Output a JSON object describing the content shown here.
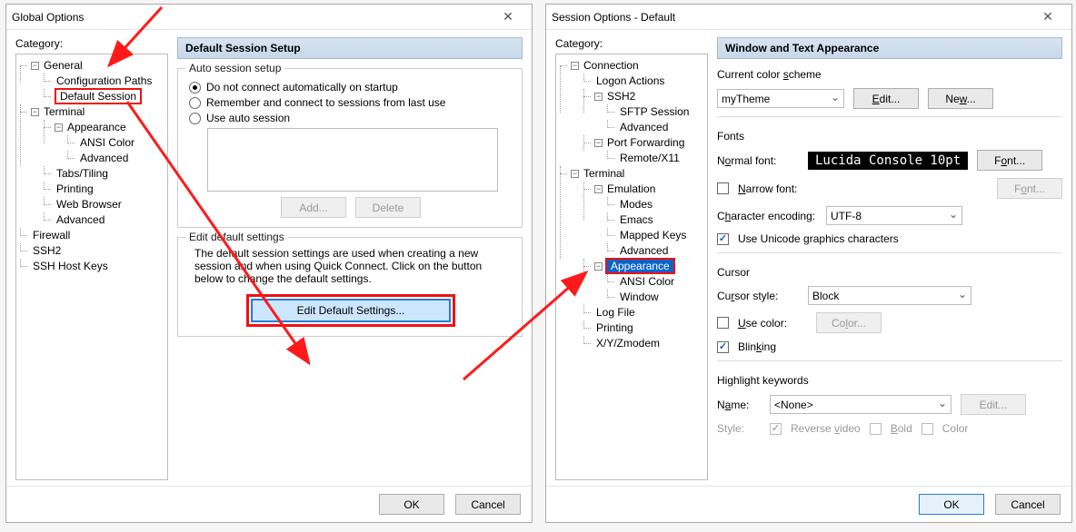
{
  "global": {
    "title": "Global Options",
    "category_label": "Category:",
    "tree": {
      "general": "General",
      "config_paths": "Configuration Paths",
      "default_session": "Default Session",
      "terminal": "Terminal",
      "appearance": "Appearance",
      "ansi_color": "ANSI Color",
      "advanced": "Advanced",
      "tabs": "Tabs/Tiling",
      "printing": "Printing",
      "web": "Web Browser",
      "advanced2": "Advanced",
      "firewall": "Firewall",
      "ssh2": "SSH2",
      "ssh_host_keys": "SSH Host Keys"
    },
    "panel_title": "Default Session Setup",
    "auto_group": "Auto session setup",
    "radio1": "Do not connect automatically on startup",
    "radio2": "Remember and connect to sessions from last use",
    "radio3": "Use auto session",
    "add_btn": "Add...",
    "delete_btn": "Delete",
    "edit_group": "Edit default settings",
    "edit_desc": "The default session settings are used when creating a new session and when using Quick Connect.  Click on the button below to change the default settings.",
    "edit_btn": "Edit Default Settings...",
    "ok": "OK",
    "cancel": "Cancel"
  },
  "session": {
    "title": "Session Options - Default",
    "category_label": "Category:",
    "tree": {
      "connection": "Connection",
      "logon": "Logon Actions",
      "ssh2": "SSH2",
      "sftp": "SFTP Session",
      "advanced": "Advanced",
      "portfwd": "Port Forwarding",
      "remotex11": "Remote/X11",
      "terminal": "Terminal",
      "emulation": "Emulation",
      "modes": "Modes",
      "emacs": "Emacs",
      "mapped": "Mapped Keys",
      "advanced2": "Advanced",
      "appearance": "Appearance",
      "ansi": "ANSI Color",
      "window": "Window",
      "logfile": "Log File",
      "printing": "Printing",
      "xyz": "X/Y/Zmodem"
    },
    "panel_title": "Window and Text Appearance",
    "color_scheme_label": "Current color scheme",
    "color_scheme_value": "myTheme",
    "edit_btn": "Edit...",
    "new_btn": "New...",
    "fonts_label": "Fonts",
    "normal_font_label": "Normal font:",
    "font_sample": "Lucida Console 10pt",
    "font_btn": "Font...",
    "narrow_font_label": "Narrow font:",
    "char_enc_label": "Character encoding:",
    "char_enc_value": "UTF-8",
    "unicode_gfx": "Use Unicode graphics characters",
    "cursor_label": "Cursor",
    "cursor_style_label": "Cursor style:",
    "cursor_style_value": "Block",
    "use_color": "Use color:",
    "color_btn": "Color...",
    "blinking": "Blinking",
    "highlight_label": "Highlight keywords",
    "name_label": "Name:",
    "name_value": "<None>",
    "hk_edit_btn": "Edit...",
    "style_label": "Style:",
    "reverse": "Reverse video",
    "bold": "Bold",
    "color_ck": "Color",
    "ok": "OK",
    "cancel": "Cancel"
  }
}
